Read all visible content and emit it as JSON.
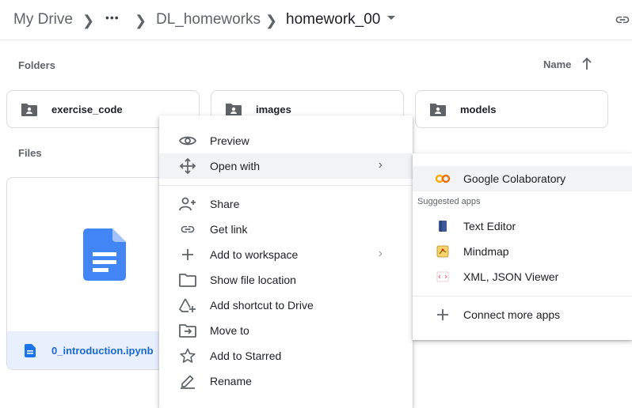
{
  "breadcrumb": {
    "root": "My Drive",
    "ellipsis": "•••",
    "parent": "DL_homeworks",
    "current": "homework_00"
  },
  "sort": {
    "label": "Name"
  },
  "folders_label": "Folders",
  "files_label": "Files",
  "folders": [
    {
      "name": "exercise_code"
    },
    {
      "name": "images"
    },
    {
      "name": "models"
    }
  ],
  "file": {
    "name": "0_introduction.ipynb"
  },
  "context_menu": {
    "items": [
      {
        "label": "Preview",
        "icon": "eye-icon"
      },
      {
        "label": "Open with",
        "icon": "move-icon"
      },
      {
        "label": "Share",
        "icon": "add-person-icon"
      },
      {
        "label": "Get link",
        "icon": "link-icon"
      },
      {
        "label": "Add to workspace",
        "icon": "plus-icon"
      },
      {
        "label": "Show file location",
        "icon": "folder-icon"
      },
      {
        "label": "Add shortcut to Drive",
        "icon": "shortcut-icon"
      },
      {
        "label": "Move to",
        "icon": "move-to-icon"
      },
      {
        "label": "Add to Starred",
        "icon": "star-icon"
      },
      {
        "label": "Rename",
        "icon": "pencil-icon"
      }
    ]
  },
  "open_with_menu": {
    "primary": {
      "label": "Google Colaboratory",
      "icon": "colab-icon"
    },
    "suggested_label": "Suggested apps",
    "suggested": [
      {
        "label": "Text Editor",
        "icon": "text-editor-icon"
      },
      {
        "label": "Mindmap",
        "icon": "mindmap-icon"
      },
      {
        "label": "XML, JSON Viewer",
        "icon": "xml-viewer-icon"
      }
    ],
    "connect": {
      "label": "Connect more apps",
      "icon": "plus-icon"
    }
  },
  "colors": {
    "accent": "#1a73e8",
    "colab": "#f9ab00",
    "selected_bg": "#e8f0fe"
  }
}
